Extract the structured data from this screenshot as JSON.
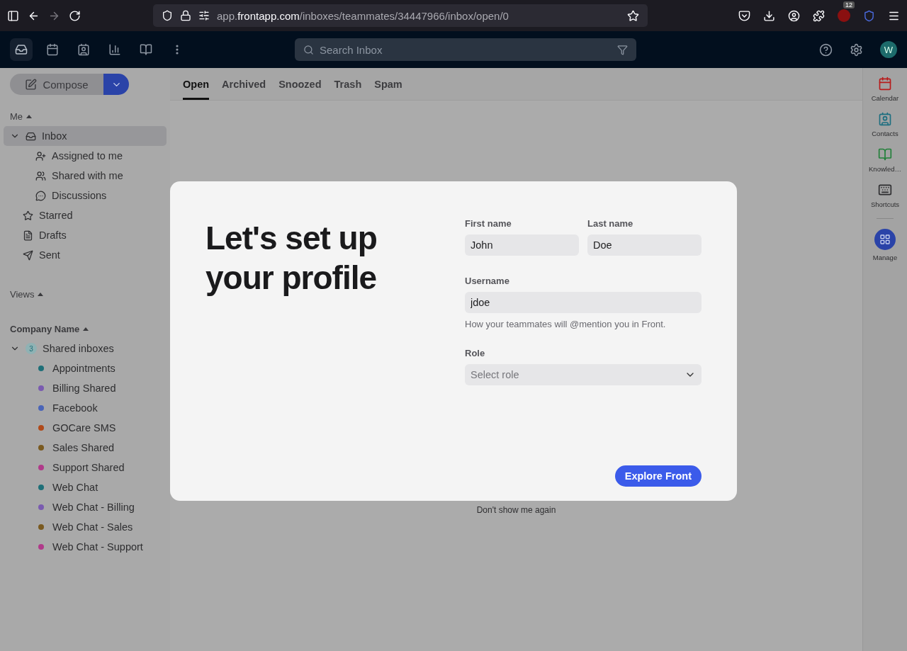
{
  "browser": {
    "url": "app.**frontapp.com**/inboxes/teammates/34447966/inbox/open/0",
    "extension_badge": "12"
  },
  "app_bar": {
    "search": {
      "placeholder": "Search Inbox"
    },
    "avatar": "W"
  },
  "sidebar": {
    "compose": "Compose",
    "me": {
      "title": "Me",
      "items": [
        {
          "label": "Inbox",
          "selected": true,
          "expanded": true,
          "children": [
            {
              "label": "Assigned to me",
              "selected": false
            },
            {
              "label": "Shared with me",
              "selected": false
            },
            {
              "label": "Discussions",
              "selected": false
            }
          ]
        },
        {
          "label": "Starred",
          "selected": false
        },
        {
          "label": "Drafts",
          "selected": false
        },
        {
          "label": "Sent",
          "selected": false
        }
      ]
    },
    "views": {
      "title": "Views"
    },
    "company": {
      "title": "Company Name",
      "group": {
        "label": "Shared inboxes",
        "count": "3",
        "expanded": true,
        "children": [
          {
            "label": "Appointments",
            "color": "#1e6f78"
          },
          {
            "label": "Billing Shared",
            "color": "#7a5bb0"
          },
          {
            "label": "Facebook",
            "color": "#4a64b8"
          },
          {
            "label": "GOCare SMS",
            "color": "#b04a1a"
          },
          {
            "label": "Sales Shared",
            "color": "#7a5a20"
          },
          {
            "label": "Support Shared",
            "color": "#b03a8a"
          },
          {
            "label": "Web Chat",
            "color": "#1e6f78"
          },
          {
            "label": "Web Chat - Billing",
            "color": "#7a5bb0"
          },
          {
            "label": "Web Chat - Sales",
            "color": "#7a5a20"
          },
          {
            "label": "Web Chat - Support",
            "color": "#b03a8a"
          }
        ]
      }
    }
  },
  "tabs": [
    {
      "label": "Open",
      "selected": true
    },
    {
      "label": "Archived",
      "selected": false
    },
    {
      "label": "Snoozed",
      "selected": false
    },
    {
      "label": "Trash",
      "selected": false
    },
    {
      "label": "Spam",
      "selected": false
    }
  ],
  "modal": {
    "title": "Let's set up your profile",
    "first_name": {
      "label": "First name",
      "value": "John"
    },
    "last_name": {
      "label": "Last name",
      "value": "Doe"
    },
    "username": {
      "label": "Username",
      "value": "jdoe",
      "hint": "How your teammates will @mention you in Front."
    },
    "role": {
      "label": "Role",
      "placeholder": "Select role"
    },
    "button": "Explore Front"
  },
  "dismiss": "Don't show me again",
  "right_rail": [
    {
      "label": "Calendar"
    },
    {
      "label": "Contacts"
    },
    {
      "label": "Knowled…"
    },
    {
      "label": "Shortcuts"
    },
    {
      "label": "Manage"
    }
  ]
}
